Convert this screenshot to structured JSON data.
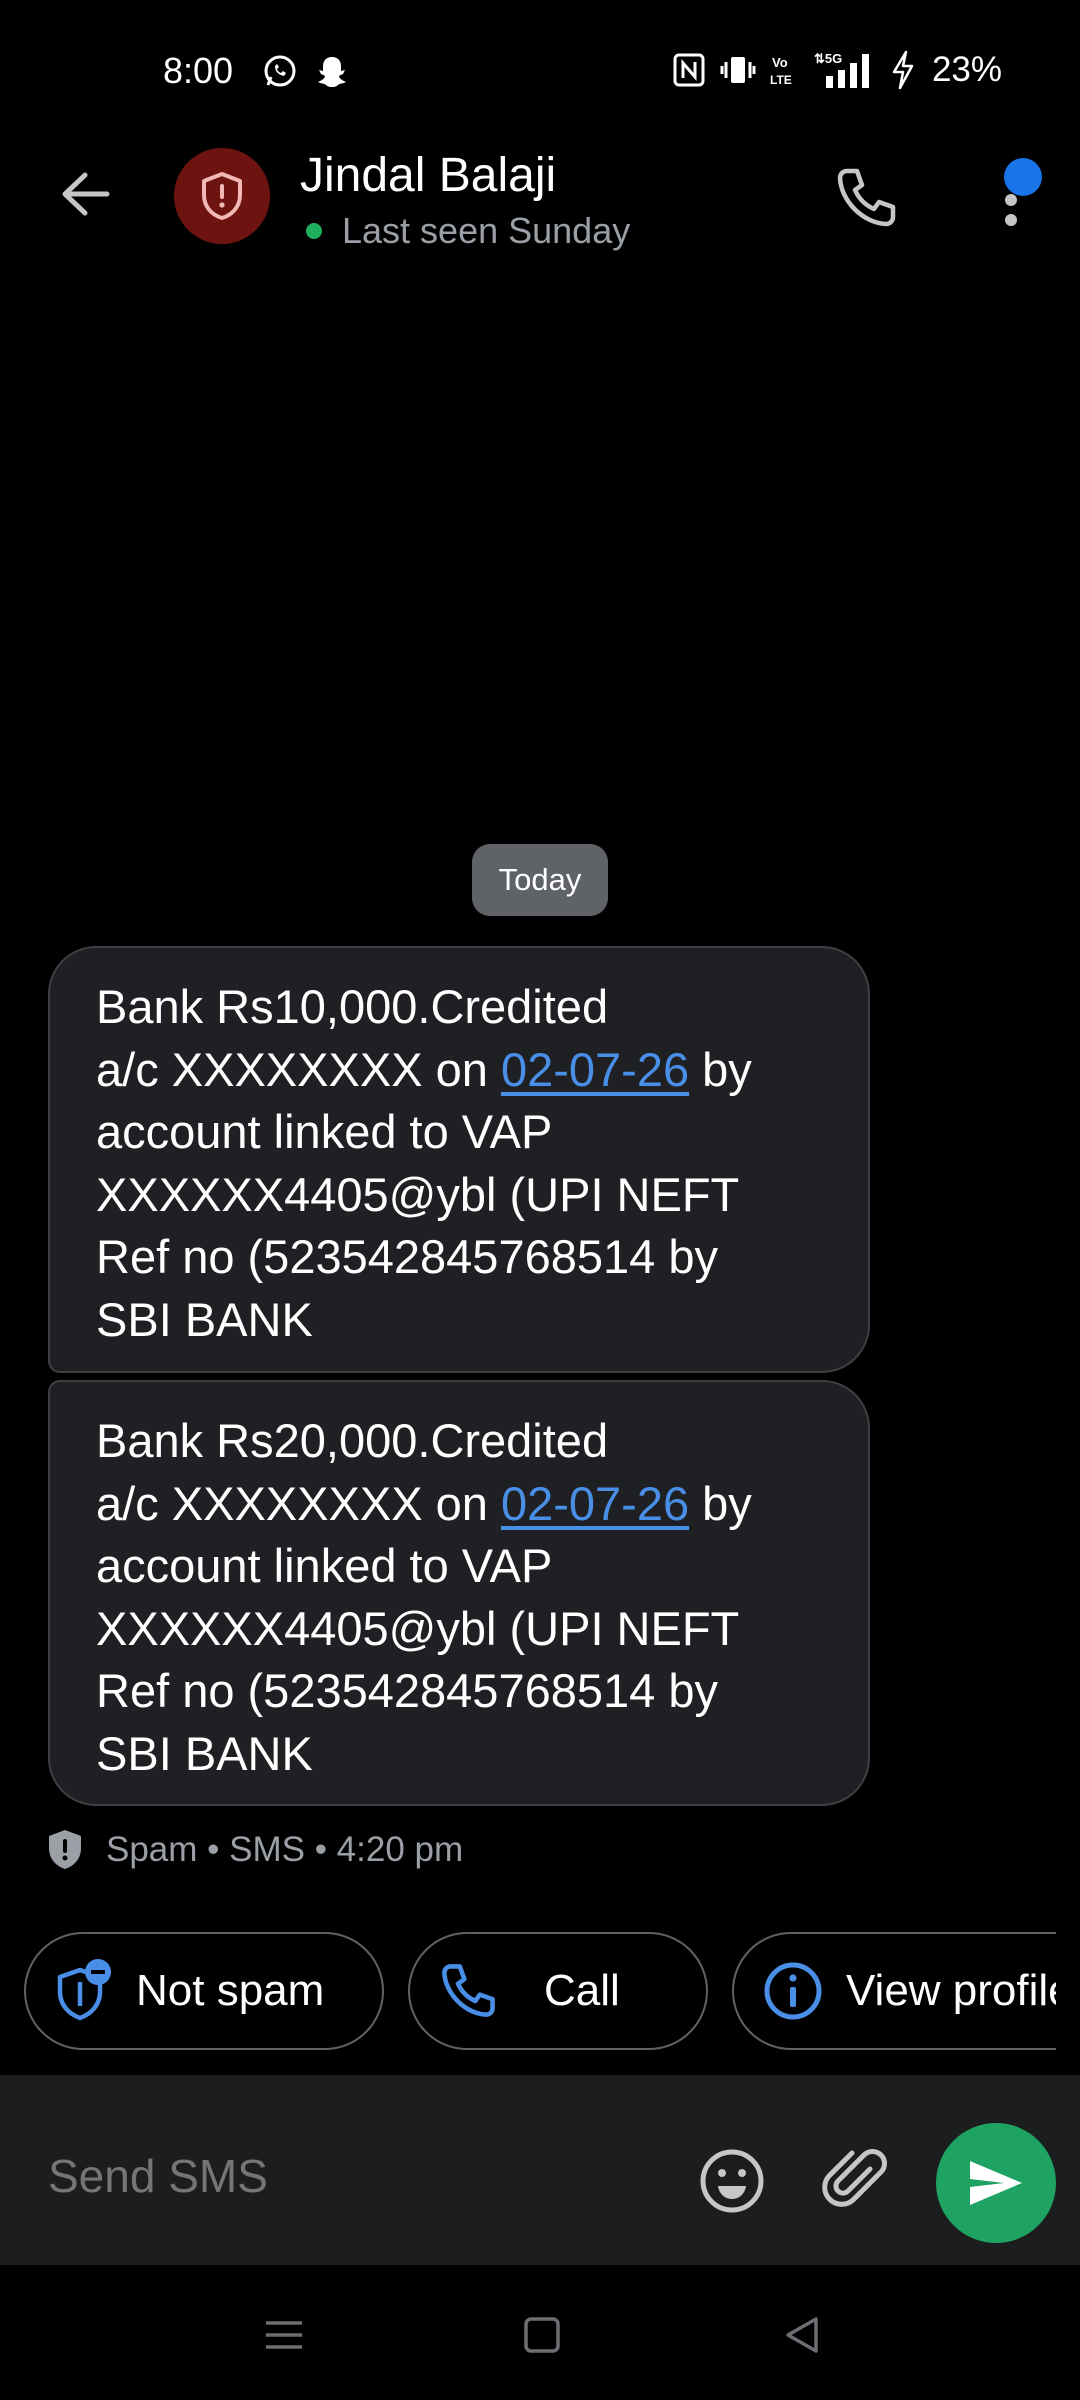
{
  "status_bar": {
    "time": "8:00",
    "icons": [
      "whatsapp-icon",
      "snapchat-icon",
      "nfc-icon",
      "vibrate-icon",
      "volte-icon",
      "5g-signal-icon",
      "charging-icon"
    ],
    "network": "5G",
    "volte": "Vo LTE",
    "battery": "23%"
  },
  "header": {
    "contact_name": "Jindal Balaji",
    "last_seen": "Last seen Sunday",
    "avatar_icon": "shield-alert-icon",
    "avatar_color": "#6d1410",
    "online_color": "#1fae5e"
  },
  "conversation": {
    "date_chip": "Today",
    "messages": [
      {
        "lines": [
          "Bank Rs10,000.Credited",
          "a/c XXXXXXXX on ",
          "account linked to VAP",
          "XXXXXX4405@ybl (UPI NEFT",
          "Ref no (523542845768514 by",
          "SBI BANK"
        ],
        "date_link": "02-07-26",
        "after_link": " by"
      },
      {
        "lines": [
          "Bank Rs20,000.Credited",
          "a/c XXXXXXXX on ",
          "account linked to VAP",
          "XXXXXX4405@ybl (UPI NEFT",
          "Ref no (523542845768514 by",
          "SBI BANK"
        ],
        "date_link": "02-07-26",
        "after_link": " by"
      }
    ],
    "meta": "Spam • SMS • 4:20 pm"
  },
  "suggestions": {
    "not_spam": "Not spam",
    "call": "Call",
    "view_profile": "View profile"
  },
  "composer": {
    "placeholder": "Send SMS"
  },
  "colors": {
    "accent_blue": "#1a73e8",
    "send_green": "#1ea362",
    "link_blue": "#4a8fe7"
  }
}
